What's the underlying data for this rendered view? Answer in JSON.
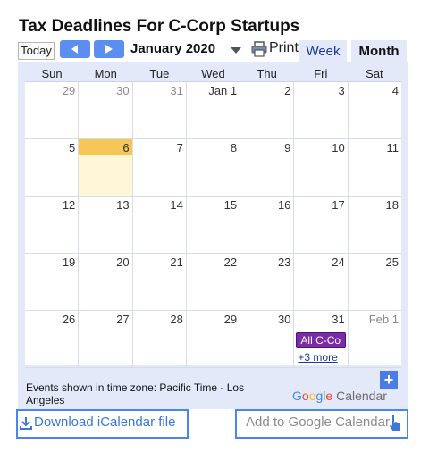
{
  "header": {
    "title": "Tax Deadlines For C-Corp Startups"
  },
  "toolbar": {
    "today_label": "Today",
    "prev_icon": "chevron-left-icon",
    "next_icon": "chevron-right-icon",
    "month_label": "January 2020",
    "print_label": "Print",
    "tabs": [
      {
        "label": "Week",
        "active": false
      },
      {
        "label": "Month",
        "active": true
      }
    ]
  },
  "calendar": {
    "weekdays": [
      "Sun",
      "Mon",
      "Tue",
      "Wed",
      "Thu",
      "Fri",
      "Sat"
    ],
    "weeks": [
      [
        "29",
        "30",
        "31",
        "Jan 1",
        "2",
        "3",
        "4"
      ],
      [
        "5",
        "6",
        "7",
        "8",
        "9",
        "10",
        "11"
      ],
      [
        "12",
        "13",
        "14",
        "15",
        "16",
        "17",
        "18"
      ],
      [
        "19",
        "20",
        "21",
        "22",
        "23",
        "24",
        "25"
      ],
      [
        "26",
        "27",
        "28",
        "29",
        "30",
        "31",
        "Feb 1"
      ]
    ],
    "other_month_cells": [
      "0-0",
      "0-1",
      "0-2",
      "4-6"
    ],
    "today_cell": "1-1",
    "event": {
      "label": "All C-Co",
      "more": "+3 more",
      "color": "#7b2aa8"
    },
    "today_color": "#f6c756",
    "frame_color": "#e3e9f8"
  },
  "footer": {
    "timezone": "Events shown in time zone: Pacific Time - Los Angeles",
    "google_brand": {
      "g1": "G",
      "o1": "o",
      "o2": "o",
      "g2": "g",
      "l": "l",
      "e": "e",
      "calendar": "Calendar"
    },
    "download_label": "Download iCalendar file",
    "add_label": "Add to Google Calendar",
    "accent_color": "#4a86e8"
  }
}
